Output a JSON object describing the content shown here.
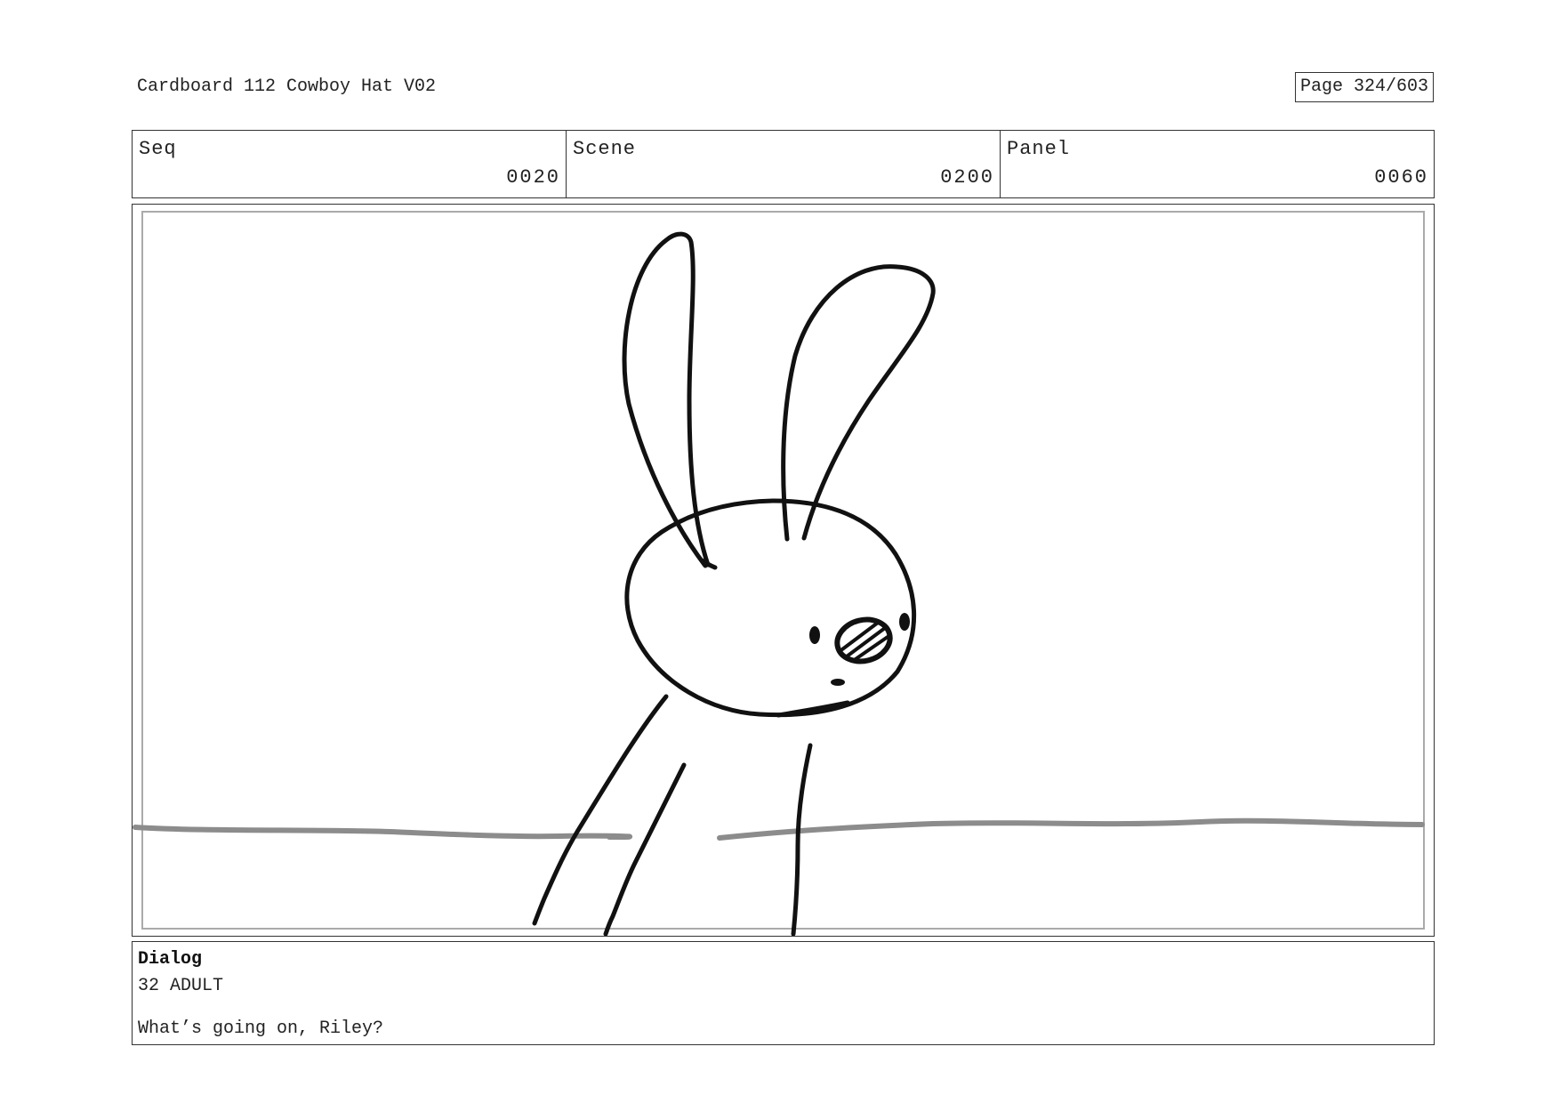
{
  "document": {
    "title": "Cardboard 112 Cowboy Hat V02",
    "page": "Page 324/603"
  },
  "info": {
    "seq": {
      "label": "Seq",
      "value": "0020"
    },
    "scene": {
      "label": "Scene",
      "value": "0200"
    },
    "panel": {
      "label": "Panel",
      "value": "0060"
    }
  },
  "dialog": {
    "heading": "Dialog",
    "speaker": "32 ADULT",
    "line": "What’s going on, Riley?"
  },
  "colors": {
    "line_art": "#111111",
    "horizon": "#8c8c8c",
    "inner_frame": "#aaaaaa",
    "border": "#333333"
  }
}
